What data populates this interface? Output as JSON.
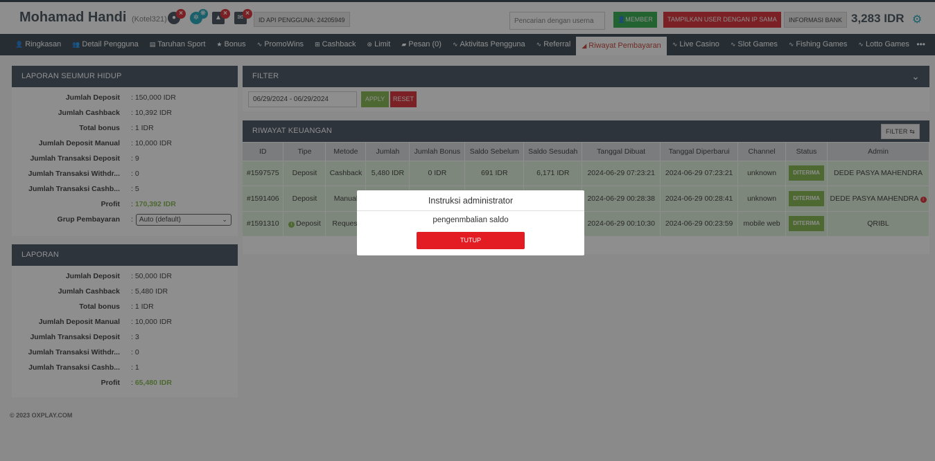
{
  "header": {
    "user_name": "Mohamad Handi",
    "user_code": "(Kotel321)",
    "api_id": "ID API PENGGUNA: 24205949",
    "search_placeholder": "Pencarian dengan userna",
    "member_label": "MEMBER",
    "same_ip_label": "TAMPILKAN USER DENGAN IP SAMA",
    "bank_info_label": "INFORMASI BANK",
    "balance": "3,283 IDR"
  },
  "nav": {
    "items": [
      {
        "label": "Ringkasan",
        "icon": "👤"
      },
      {
        "label": "Detail Pengguna",
        "icon": "👥"
      },
      {
        "label": "Taruhan Sport",
        "icon": "▤"
      },
      {
        "label": "Bonus",
        "icon": "★"
      },
      {
        "label": "PromoWins",
        "icon": "∿"
      },
      {
        "label": "Cashback",
        "icon": "⊞"
      },
      {
        "label": "Limit",
        "icon": "⊛"
      },
      {
        "label": "Pesan (0)",
        "icon": "▰"
      },
      {
        "label": "Aktivitas Pengguna",
        "icon": "∿"
      },
      {
        "label": "Referral",
        "icon": "∿"
      },
      {
        "label": "Riwayat Pembayaran",
        "icon": "◢"
      },
      {
        "label": "Live Casino",
        "icon": "∿"
      },
      {
        "label": "Slot Games",
        "icon": "∿"
      },
      {
        "label": "Fishing Games",
        "icon": "∿"
      },
      {
        "label": "Lotto Games",
        "icon": "∿"
      }
    ],
    "more": "•••"
  },
  "lifetime": {
    "title": "LAPORAN SEUMUR HIDUP",
    "rows": [
      {
        "k": "Jumlah Deposit",
        "v": ": 150,000 IDR"
      },
      {
        "k": "Jumlah Cashback",
        "v": ": 10,392 IDR"
      },
      {
        "k": "Total bonus",
        "v": ": 1 IDR"
      },
      {
        "k": "Jumlah Deposit Manual",
        "v": ": 10,000 IDR"
      },
      {
        "k": "Jumlah Transaksi Deposit",
        "v": ": 9"
      },
      {
        "k": "Jumlah Transaksi Withdr...",
        "v": ": 0"
      },
      {
        "k": "Jumlah Transaksi Cashb...",
        "v": ": 5"
      },
      {
        "k": "Profit",
        "v_prefix": ":",
        "v": "170,392 IDR"
      }
    ],
    "group_label": "Grup Pembayaran",
    "group_prefix": ":",
    "group_value": "Auto (default)"
  },
  "report": {
    "title": "LAPORAN",
    "rows": [
      {
        "k": "Jumlah Deposit",
        "v": ": 50,000 IDR"
      },
      {
        "k": "Jumlah Cashback",
        "v": ": 5,480 IDR"
      },
      {
        "k": "Total bonus",
        "v": ": 1 IDR"
      },
      {
        "k": "Jumlah Deposit Manual",
        "v": ": 10,000 IDR"
      },
      {
        "k": "Jumlah Transaksi Deposit",
        "v": ": 3"
      },
      {
        "k": "Jumlah Transaksi Withdr...",
        "v": ": 0"
      },
      {
        "k": "Jumlah Transaksi Cashb...",
        "v": ": 1"
      },
      {
        "k": "Profit",
        "v_prefix": ":",
        "v": "65,480 IDR"
      }
    ]
  },
  "filter": {
    "title": "FILTER",
    "date_range": "06/29/2024 - 06/29/2024",
    "apply": "APPLY",
    "reset": "RESET"
  },
  "finance": {
    "title": "RIWAYAT KEUANGAN",
    "filter_btn": "FILTER ⇆",
    "columns": [
      "ID",
      "Tipe",
      "Metode",
      "Jumlah",
      "Jumlah Bonus",
      "Saldo Sebelum",
      "Saldo Sesudah",
      "Tanggal Dibuat",
      "Tanggal Diperbarui",
      "Channel",
      "Status",
      "Admin"
    ],
    "rows": [
      {
        "id": "#1597575",
        "tipe": "Deposit",
        "metode": "Cashback",
        "jumlah": "5,480 IDR",
        "bonus": "0 IDR",
        "sebelum": "691 IDR",
        "sesudah": "6,171 IDR",
        "dibuat": "2024-06-29 07:23:21",
        "diperbarui": "2024-06-29 07:23:21",
        "channel": "unknown",
        "status": "DITERIMA",
        "admin": "DEDE PASYA MAHENDRA"
      },
      {
        "id": "#1591406",
        "tipe": "Deposit",
        "metode": "Manual",
        "jumlah": "",
        "bonus": "",
        "sebelum": "",
        "sesudah": "",
        "dibuat": "2024-06-29 00:28:38",
        "diperbarui": "2024-06-29 00:28:41",
        "channel": "unknown",
        "status": "DITERIMA",
        "admin": "DEDE PASYA MAHENDRA"
      },
      {
        "id": "#1591310",
        "tipe": "Deposit",
        "metode": "Request",
        "jumlah": "",
        "bonus": "",
        "sebelum": "",
        "sesudah": "",
        "dibuat": "2024-06-29 00:10:30",
        "diperbarui": "2024-06-29 00:23:59",
        "channel": "mobile web",
        "status": "DITERIMA",
        "admin": "QRIBL"
      }
    ]
  },
  "footer": "© 2023 OXPLAY.COM",
  "modal": {
    "title": "Instruksi administrator",
    "body": "pengenmbalian saldo",
    "close": "TUTUP"
  },
  "colors": {
    "accent_red": "#e31c23",
    "green": "#7cb342",
    "nav_bg": "#2f3e4b"
  }
}
